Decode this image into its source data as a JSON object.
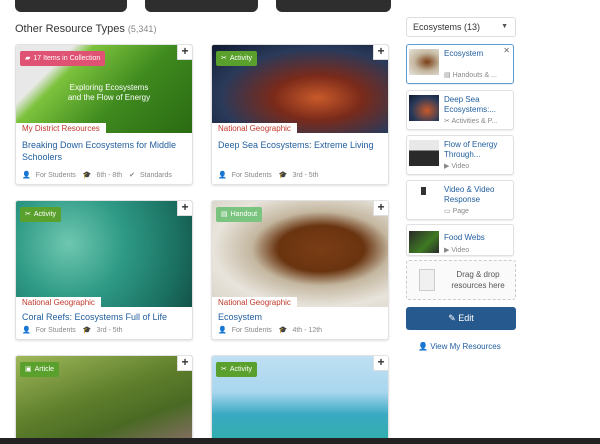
{
  "section": {
    "title": "Other Resource Types",
    "count": "(5,341)"
  },
  "cards": [
    {
      "badge": "17 Items in Collection",
      "badge_icon": "folder-icon",
      "source": "My District Resources",
      "title": "Breaking Down Ecosystems for Middle Schoolers",
      "meta": {
        "audience": "For Students",
        "grades": "6th - 8th",
        "extra": "Standards"
      },
      "cover_text": "Exploring Ecosystems and the Flow of Energy"
    },
    {
      "badge": "Activity",
      "badge_icon": "scissors-icon",
      "source": "National Geographic",
      "title": "Deep Sea Ecosystems: Extreme Living",
      "meta": {
        "audience": "For Students",
        "grades": "3rd - 5th"
      }
    },
    {
      "badge": "Activity",
      "badge_icon": "scissors-icon",
      "source": "National Geographic",
      "title": "Coral Reefs: Ecosystems Full of Life",
      "meta": {
        "audience": "For Students",
        "grades": "3rd - 5th"
      }
    },
    {
      "badge": "Handout",
      "badge_icon": "handout-icon",
      "source": "National Geographic",
      "title": "Ecosystem",
      "meta": {
        "audience": "For Students",
        "grades": "4th - 12th"
      }
    },
    {
      "badge": "Article",
      "badge_icon": "article-icon"
    },
    {
      "badge": "Activity",
      "badge_icon": "scissors-icon"
    }
  ],
  "panel": {
    "dropdown": "Ecosystems (13)",
    "items": [
      {
        "title": "Ecosystem",
        "type": "Handouts & ..."
      },
      {
        "title": "Deep Sea Ecosystems:...",
        "type": "Activities & P..."
      },
      {
        "title": "Flow of Energy Through...",
        "type": "Video"
      },
      {
        "title": "Video & Video Response",
        "type": "Page"
      },
      {
        "title": "Food Webs",
        "type": "Video"
      }
    ],
    "dropzone": "Drag & drop resources here",
    "edit": "Edit",
    "view_link": "View My Resources"
  },
  "colors": {
    "accent": "#265a8e",
    "link": "#1f5d9e",
    "source": "#c0392b",
    "activity": "#5aa02c",
    "collection": "#e05273"
  }
}
